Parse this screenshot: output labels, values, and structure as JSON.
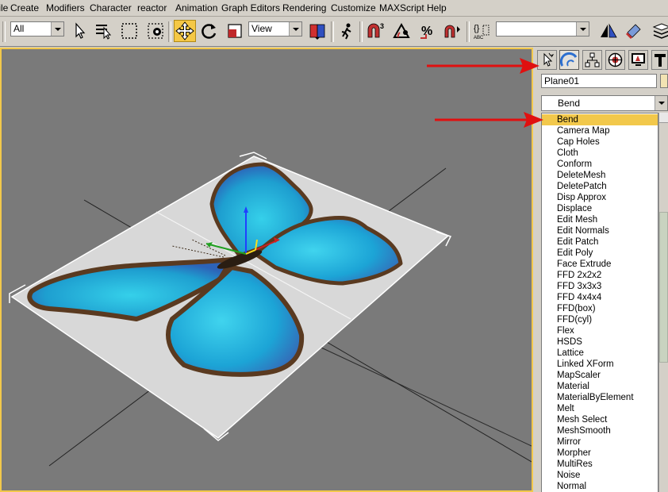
{
  "menu": {
    "items": [
      "File",
      "Create",
      "Modifiers",
      "Character",
      "reactor",
      "Animation",
      "Graph Editors",
      "Rendering",
      "Customize",
      "MAXScript",
      "Help"
    ]
  },
  "toolbar": {
    "selection_filter": "All",
    "reference_coord": "View",
    "named_selection": "",
    "active_tool_icon": "select-and-move-icon"
  },
  "command_panel": {
    "active_tab": "modify",
    "object_name": "Plane01",
    "object_color": "#f2e3b3",
    "modifier_list_value": "Bend",
    "selected_modifier": "Bend",
    "modifiers": [
      "Bend",
      "Camera Map",
      "Cap Holes",
      "Cloth",
      "Conform",
      "DeleteMesh",
      "DeletePatch",
      "Disp Approx",
      "Displace",
      "Edit Mesh",
      "Edit Normals",
      "Edit Patch",
      "Edit Poly",
      "Face Extrude",
      "FFD 2x2x2",
      "FFD 3x3x3",
      "FFD 4x4x4",
      "FFD(box)",
      "FFD(cyl)",
      "Flex",
      "HSDS",
      "Lattice",
      "Linked XForm",
      "MapScaler",
      "Material",
      "MaterialByElement",
      "Melt",
      "Mesh Select",
      "MeshSmooth",
      "Mirror",
      "Morpher",
      "MultiRes",
      "Noise",
      "Normal"
    ]
  },
  "colors": {
    "accent": "#f2c84b",
    "viewport_bg": "#7a7a7a",
    "annotation_arrow": "#e01010"
  }
}
